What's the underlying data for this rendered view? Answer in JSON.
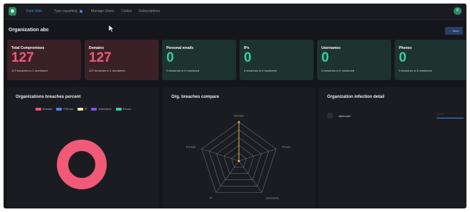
{
  "nav": {
    "items": [
      {
        "label": "Dark Web",
        "active": true
      },
      {
        "label": "Typo squatting",
        "active": false,
        "badge": true
      },
      {
        "label": "Manage Users",
        "active": false
      },
      {
        "label": "Codes",
        "active": false
      },
      {
        "label": "Subscriptions",
        "active": false
      }
    ],
    "avatar_initial": "R"
  },
  "page": {
    "title": "Organization abc",
    "back_label": "←  Back"
  },
  "cards": [
    {
      "label": "Total Compromises",
      "value": "127",
      "sub": "127 breaches in 1 monitored",
      "tone": "red"
    },
    {
      "label": "Domains",
      "value": "127",
      "sub": "127 breaches in 1 monitored",
      "tone": "red"
    },
    {
      "label": "Personal emails",
      "value": "0",
      "sub": "0 breaches in 0 monitored",
      "tone": "teal"
    },
    {
      "label": "IPs",
      "value": "0",
      "sub": "0 breaches in 0 monitored",
      "tone": "teal"
    },
    {
      "label": "Usernames",
      "value": "0",
      "sub": "0 breaches in 0 monitored",
      "tone": "teal"
    },
    {
      "label": "Phones",
      "value": "0",
      "sub": "0 breaches in 0 monitored",
      "tone": "teal"
    }
  ],
  "colors": {
    "accent": "#3d8bf2",
    "danger": "#f05a76",
    "success": "#2fd4a4",
    "radar": "#f5c542"
  },
  "panels": {
    "donut_title": "Organizations breaches percent",
    "radar_title": "Org. breaches compare",
    "infection_title": "Organization infection detail"
  },
  "infection": {
    "items": [
      {
        "label": "zaba.com",
        "percent_text": "100%",
        "percent": 100
      }
    ]
  },
  "chart_data": [
    {
      "type": "pie",
      "title": "Organizations breaches percent",
      "legend": [
        {
          "name": "Domain",
          "color": "#f05a76"
        },
        {
          "name": "P.Email",
          "color": "#3d8bf2"
        },
        {
          "name": "IP",
          "color": "#f3e6a4"
        },
        {
          "name": "Username",
          "color": "#7b4ff0"
        },
        {
          "name": "Phone",
          "color": "#2fd4a4"
        }
      ],
      "categories": [
        "Domain",
        "P.Email",
        "IP",
        "Username",
        "Phone"
      ],
      "values": [
        127,
        0,
        0,
        0,
        0
      ],
      "legend_position": "top"
    },
    {
      "type": "radar",
      "title": "Org. breaches compare",
      "axes": [
        "Domain",
        "Phone",
        "Username",
        "IP",
        "P.Email"
      ],
      "values": [
        127,
        0,
        0,
        0,
        0
      ],
      "ylim": [
        0,
        127
      ],
      "rings": 5
    }
  ]
}
